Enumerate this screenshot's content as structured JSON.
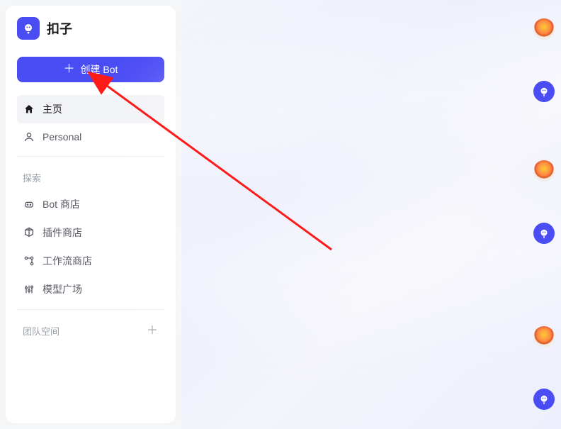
{
  "brand": {
    "name": "扣子"
  },
  "create_button": {
    "label": "创建 Bot"
  },
  "nav": {
    "home": "主页",
    "personal": "Personal"
  },
  "explore": {
    "title": "探索",
    "bot_store": "Bot 商店",
    "plugin_store": "插件商店",
    "workflow_store": "工作流商店",
    "model_plaza": "模型广场"
  },
  "team_space": {
    "title": "团队空间"
  },
  "rail": {
    "items": [
      {
        "kind": "balloon"
      },
      {
        "kind": "bot"
      },
      {
        "kind": "balloon"
      },
      {
        "kind": "bot"
      },
      {
        "kind": "balloon"
      },
      {
        "kind": "bot"
      }
    ],
    "gaps": [
      58,
      82,
      58,
      116,
      58
    ]
  },
  "colors": {
    "accent": "#4a4cf4",
    "annotation": "#ff1a1a"
  }
}
